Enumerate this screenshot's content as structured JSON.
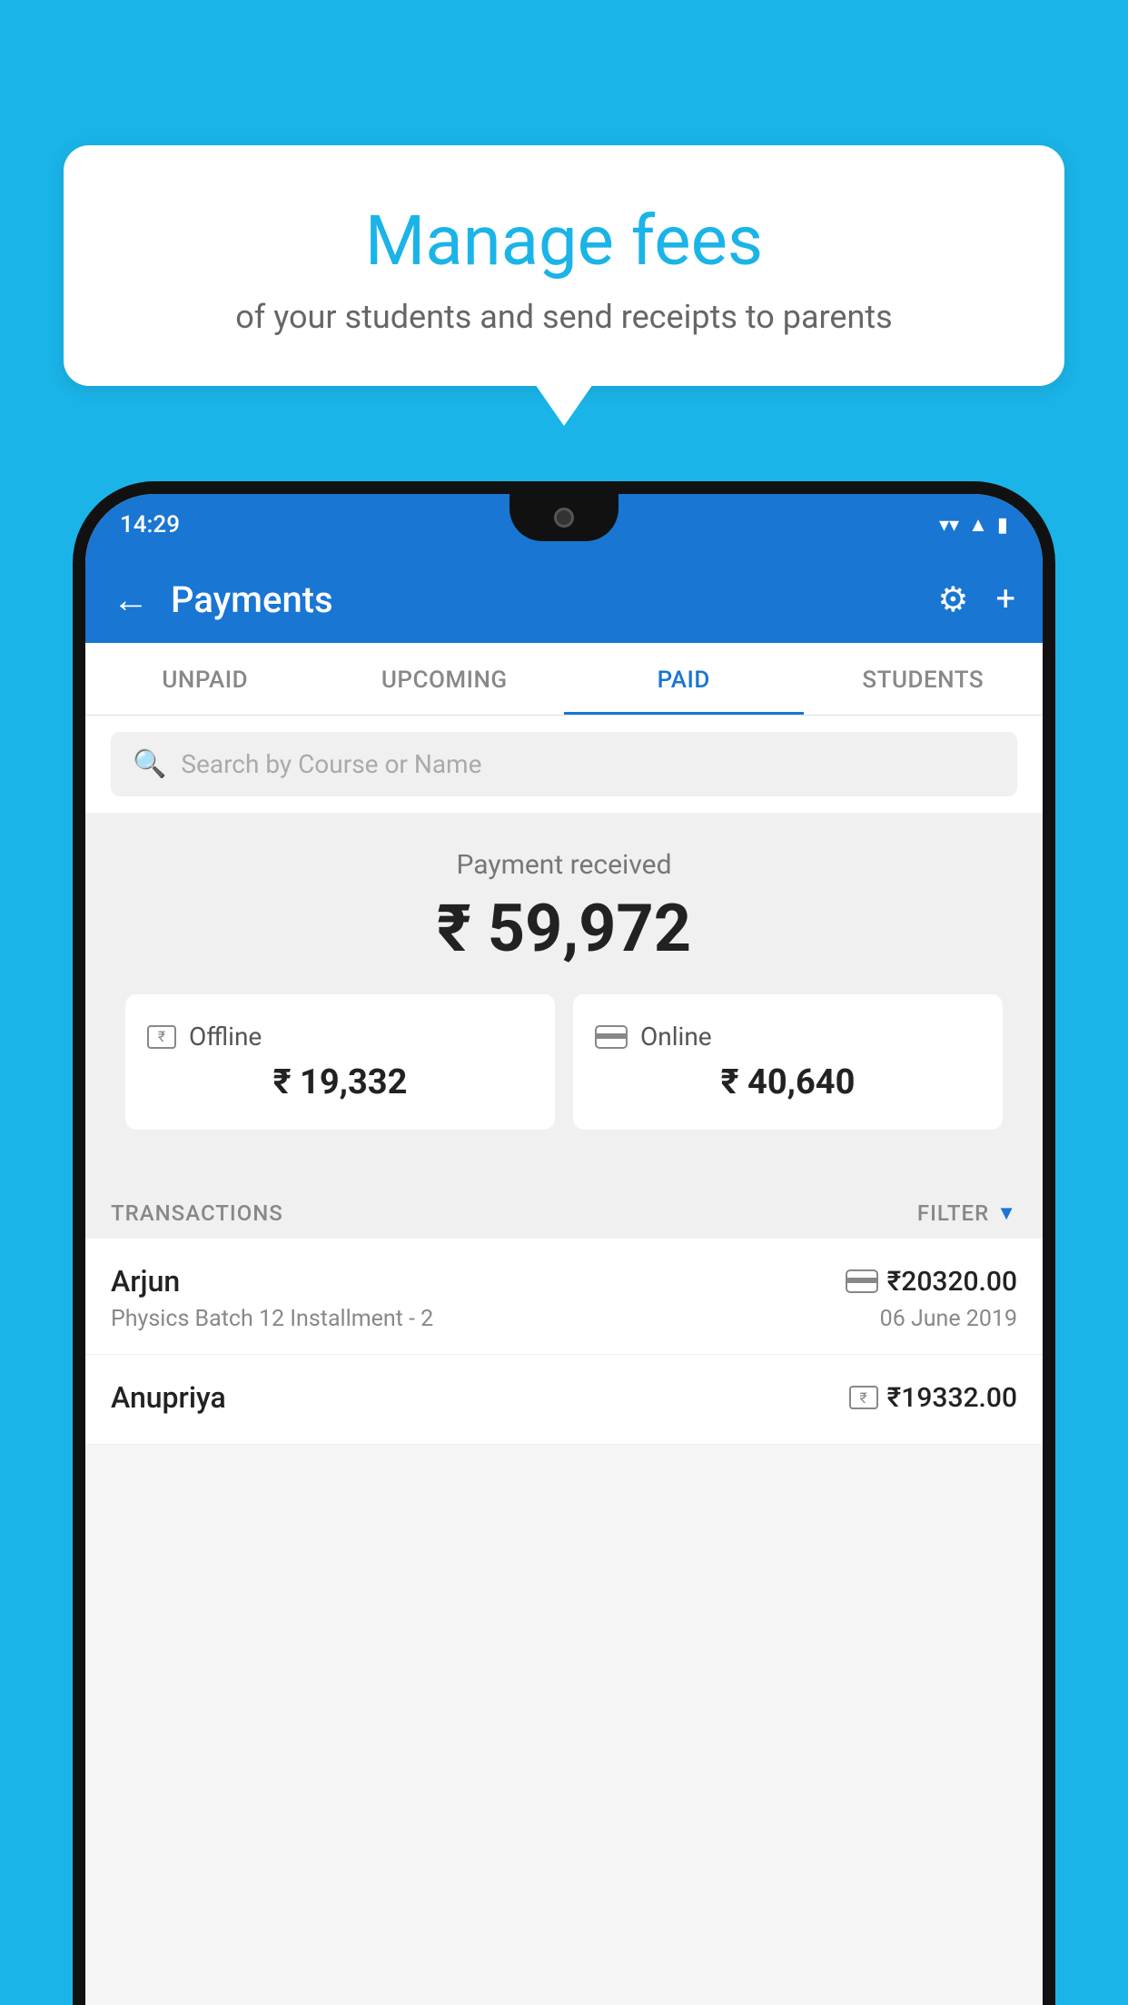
{
  "background_color": "#1ab4e8",
  "speech_bubble": {
    "title": "Manage fees",
    "subtitle": "of your students and send receipts to parents"
  },
  "phone": {
    "status_bar": {
      "time": "14:29",
      "wifi": "▼",
      "signal": "▲",
      "battery": "▮"
    },
    "header": {
      "title": "Payments",
      "back_label": "←",
      "settings_label": "⚙",
      "add_label": "+"
    },
    "tabs": [
      {
        "label": "UNPAID",
        "active": false
      },
      {
        "label": "UPCOMING",
        "active": false
      },
      {
        "label": "PAID",
        "active": true
      },
      {
        "label": "STUDENTS",
        "active": false
      }
    ],
    "search": {
      "placeholder": "Search by Course or Name"
    },
    "payment_received": {
      "label": "Payment received",
      "amount": "₹ 59,972"
    },
    "cards": [
      {
        "type": "Offline",
        "amount": "₹ 19,332",
        "icon": "rupee-box"
      },
      {
        "type": "Online",
        "amount": "₹ 40,640",
        "icon": "card"
      }
    ],
    "transactions_section": {
      "label": "TRANSACTIONS",
      "filter_label": "FILTER"
    },
    "transactions": [
      {
        "name": "Arjun",
        "course": "Physics Batch 12 Installment - 2",
        "amount": "₹20320.00",
        "date": "06 June 2019",
        "payment_type": "online"
      },
      {
        "name": "Anupriya",
        "course": "",
        "amount": "₹19332.00",
        "date": "",
        "payment_type": "offline"
      }
    ]
  }
}
